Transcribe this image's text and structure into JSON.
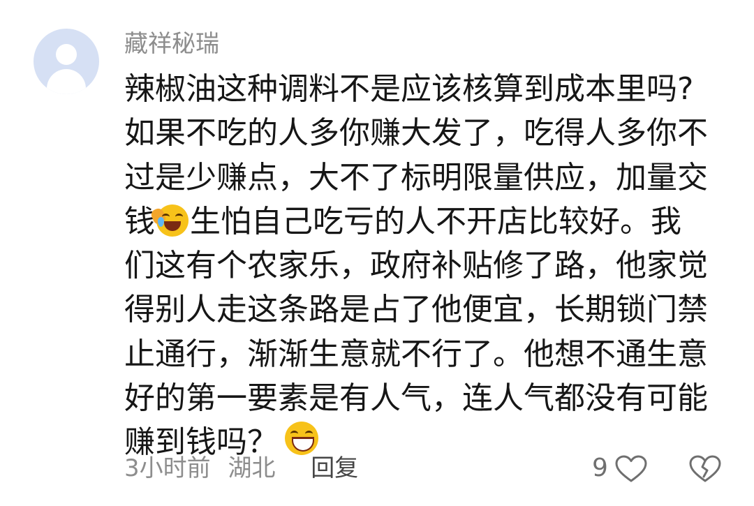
{
  "comment": {
    "username": "藏祥秘瑞",
    "body_lines": [
      "辣椒油这种调料不是应该核算到成本里吗?",
      "如果不吃的人多你赚大发了，吃得人多你不",
      "过是少赚点，大不了标明限量供应，加量交",
      "钱",
      "生怕自己吃亏的人不开店比较好。我",
      "们这有个农家乐，政府补贴修了路，他家觉",
      "得别人走这条路是占了他便宜，长期锁门禁",
      "止通行，渐渐生意就不行了。他想不通生意",
      "好的第一要素是有人气，连人气都没有可能",
      "赚到钱吗？"
    ],
    "emojis": [
      "crying-laughing-emoji",
      "laughing-emoji"
    ],
    "time": "3小时前",
    "location": "湖北",
    "reply_label": "回复",
    "like_count": "9",
    "colors": {
      "text": "#161616",
      "meta": "#8d8d8d",
      "avatar_bg": "#d6e0f4"
    }
  }
}
